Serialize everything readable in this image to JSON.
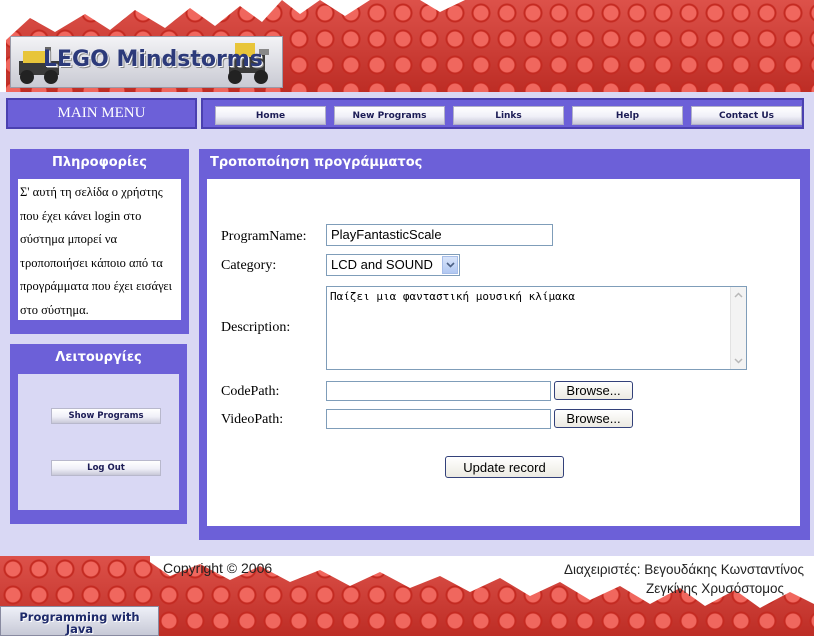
{
  "header": {
    "logo_text": "LEGO Mindstorms"
  },
  "menu": {
    "title": "MAIN MENU",
    "items": [
      {
        "label": "Home"
      },
      {
        "label": "New Programs"
      },
      {
        "label": "Links"
      },
      {
        "label": "Help"
      },
      {
        "label": "Contact Us"
      }
    ]
  },
  "info": {
    "title": "Πληροφορίες",
    "text": "Σ' αυτή τη σελίδα ο χρήστης που έχει κάνει login στο σύστημα μπορεί να τροποποιήσει κάποιο από τα προγράμματα που έχει εισάγει στο σύστημα."
  },
  "operations": {
    "title": "Λειτουργίες",
    "show_programs": "Show Programs",
    "logout": "Log Out"
  },
  "form": {
    "title": "Τροποποίηση προγράμματος",
    "program_name_label": "ProgramName:",
    "program_name_value": "PlayFantasticScale",
    "category_label": "Category:",
    "category_value": "LCD and SOUND",
    "description_label": "Description:",
    "description_value": "Παίζει μια φανταστική μουσική κλίμακα",
    "codepath_label": "CodePath:",
    "codepath_value": "",
    "videopath_label": "VideoPath:",
    "videopath_value": "",
    "browse_label": "Browse...",
    "update_label": "Update record"
  },
  "footer": {
    "copyright": "Copyright © 2006",
    "admins_line1": "Διαχειριστές: Βεγουδάκης Κωνσταντίνος",
    "admins_line2": "Ζεγκίνης Χρυσόστομος",
    "badge_line1": "Programming with",
    "badge_line2": "Java"
  },
  "colors": {
    "panel": "#6c60d8",
    "page_bg": "#d9d8f4",
    "lego_red": "#d7332a"
  }
}
